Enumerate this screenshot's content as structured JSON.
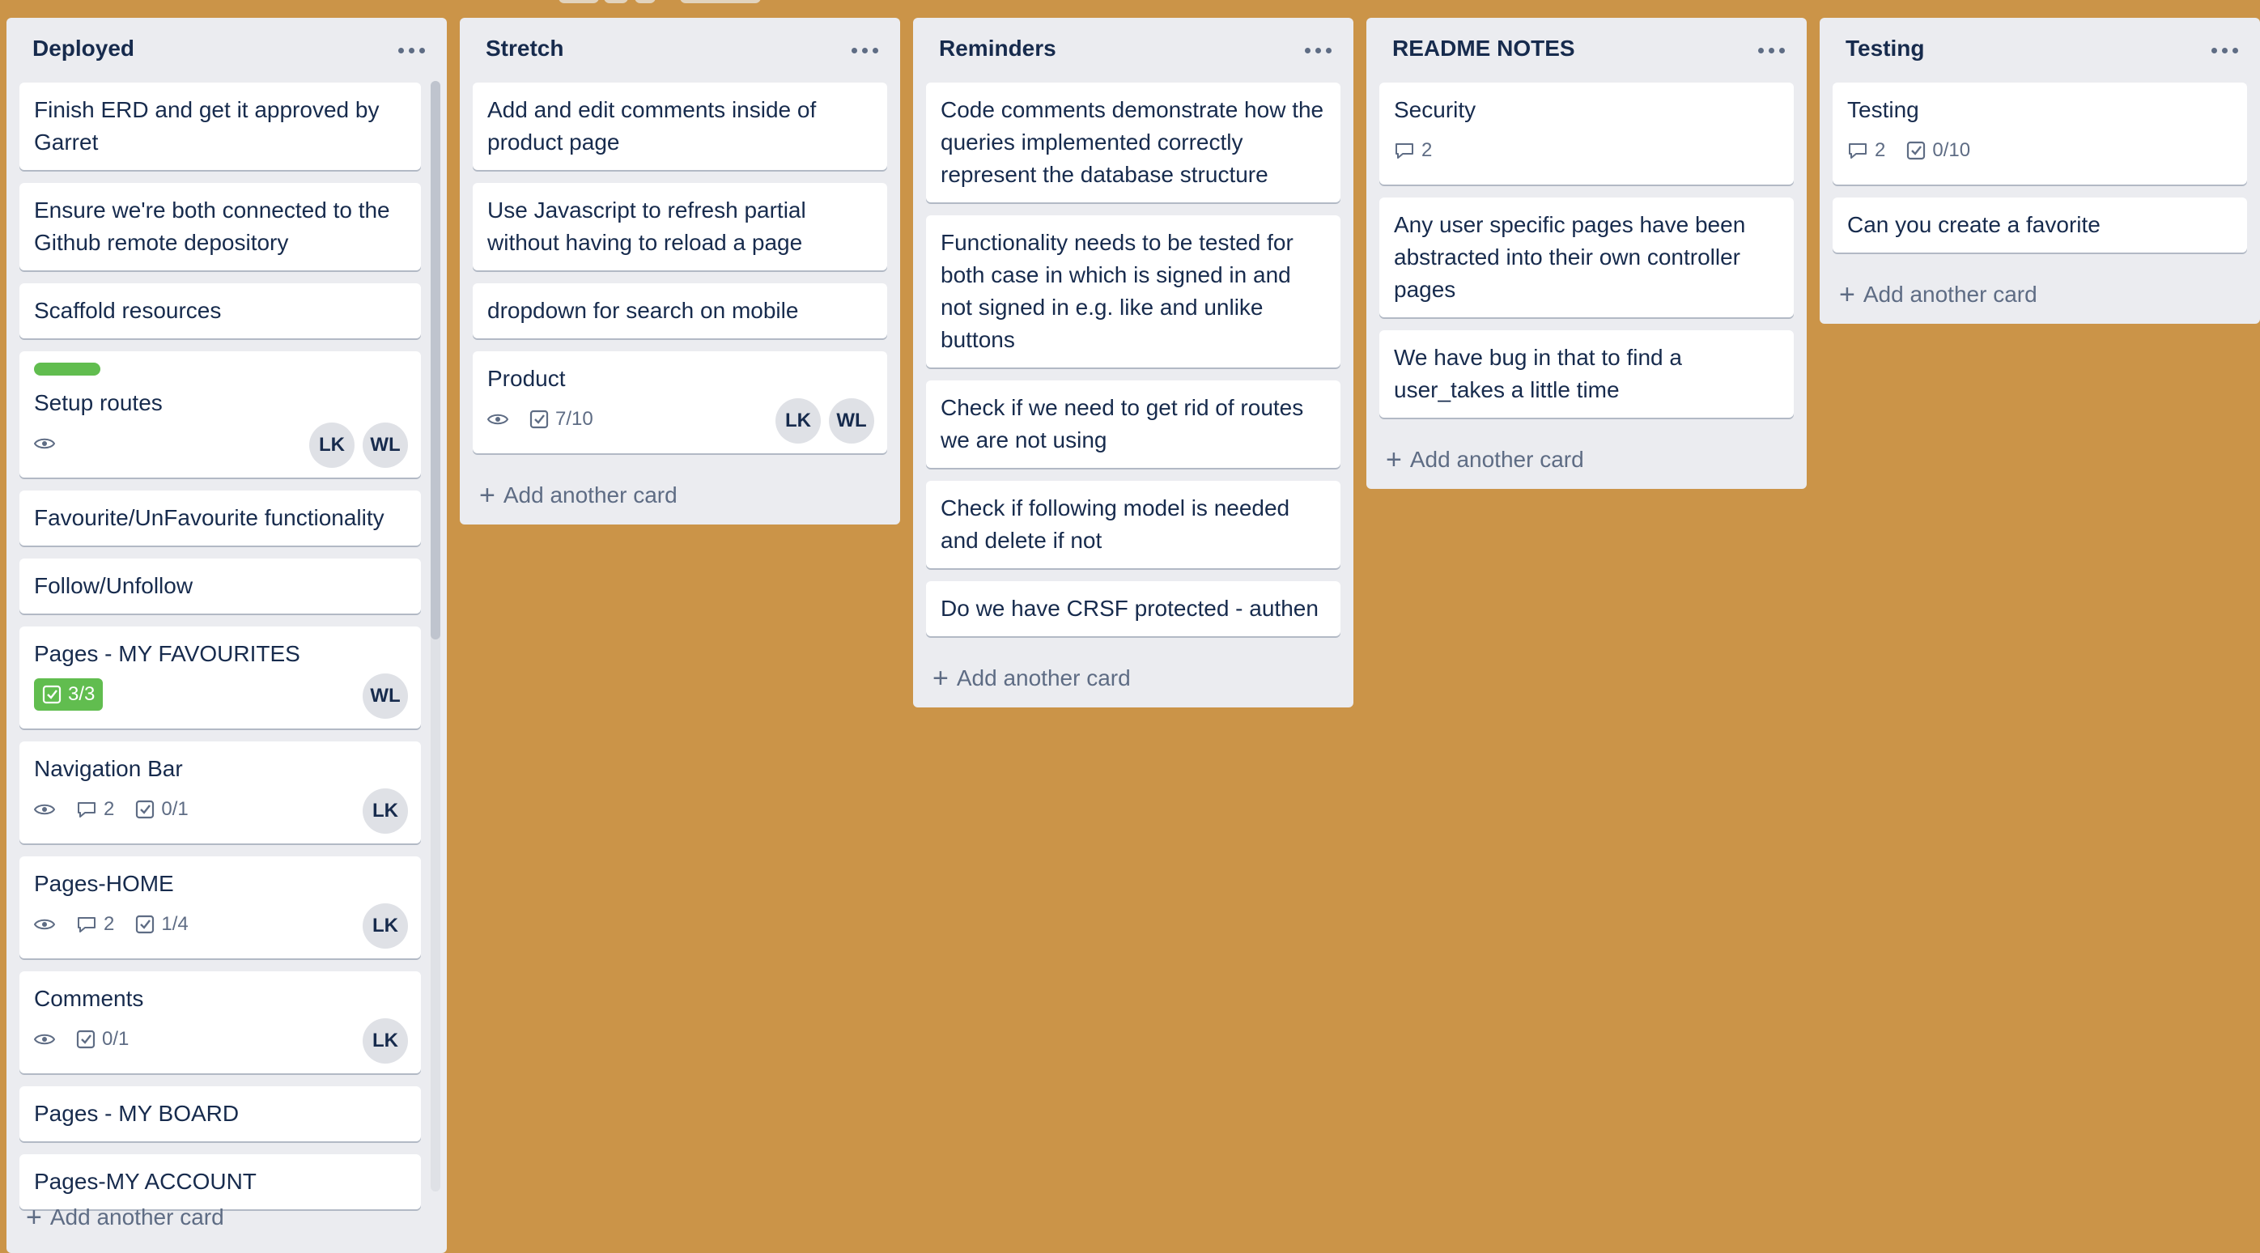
{
  "colors": {
    "board_bg": "#cb9448",
    "list_bg": "#ebecf0",
    "label_green": "#61bd4f"
  },
  "lists": [
    {
      "title": "Deployed",
      "add_label": "Add another card",
      "cards": [
        {
          "text": "Finish ERD and get it approved by Garret"
        },
        {
          "text": "Ensure we're both connected to the Github remote depository"
        },
        {
          "text": "Scaffold resources"
        },
        {
          "text": "Setup routes",
          "label": "green",
          "watch": true,
          "members": [
            "LK",
            "WL"
          ]
        },
        {
          "text": "Favourite/UnFavourite functionality"
        },
        {
          "text": "Follow/Unfollow"
        },
        {
          "text": "Pages - MY FAVOURITES",
          "checklist_complete": "3/3",
          "members": [
            "WL"
          ]
        },
        {
          "text": "Navigation Bar",
          "watch": true,
          "comments": "2",
          "checklist": "0/1",
          "members": [
            "LK"
          ]
        },
        {
          "text": "Pages-HOME",
          "watch": true,
          "comments": "2",
          "checklist": "1/4",
          "members": [
            "LK"
          ]
        },
        {
          "text": "Comments",
          "watch": true,
          "checklist": "0/1",
          "members": [
            "LK"
          ]
        },
        {
          "text": "Pages - MY BOARD"
        },
        {
          "text": "Pages-MY ACCOUNT"
        }
      ]
    },
    {
      "title": "Stretch",
      "add_label": "Add another card",
      "cards": [
        {
          "text": "Add and edit comments inside of product page"
        },
        {
          "text": "Use Javascript to refresh partial without having to reload a page"
        },
        {
          "text": "dropdown for search on mobile"
        },
        {
          "text": "Product",
          "watch": true,
          "checklist": "7/10",
          "members": [
            "LK",
            "WL"
          ]
        }
      ]
    },
    {
      "title": "Reminders",
      "add_label": "Add another card",
      "cards": [
        {
          "text": "Code comments demonstrate how the queries implemented correctly represent the database structure"
        },
        {
          "text": "Functionality needs to be tested for both case in which is signed in and not signed in e.g. like and unlike buttons"
        },
        {
          "text": "Check if we need to get rid of routes we are not using"
        },
        {
          "text": "Check if following model is needed and delete if not"
        },
        {
          "text": "Do we have CRSF protected - authen"
        }
      ]
    },
    {
      "title": "README NOTES",
      "add_label": "Add another card",
      "cards": [
        {
          "text": "Security",
          "comments": "2"
        },
        {
          "text": "Any user specific pages have been abstracted into their own controller pages"
        },
        {
          "text": "We have bug in that to find a user_takes a little time"
        }
      ]
    },
    {
      "title": "Testing",
      "add_label": "Add another card",
      "cards": [
        {
          "text": "Testing",
          "comments": "2",
          "checklist": "0/10"
        },
        {
          "text": "Can you create a favorite"
        }
      ]
    }
  ]
}
